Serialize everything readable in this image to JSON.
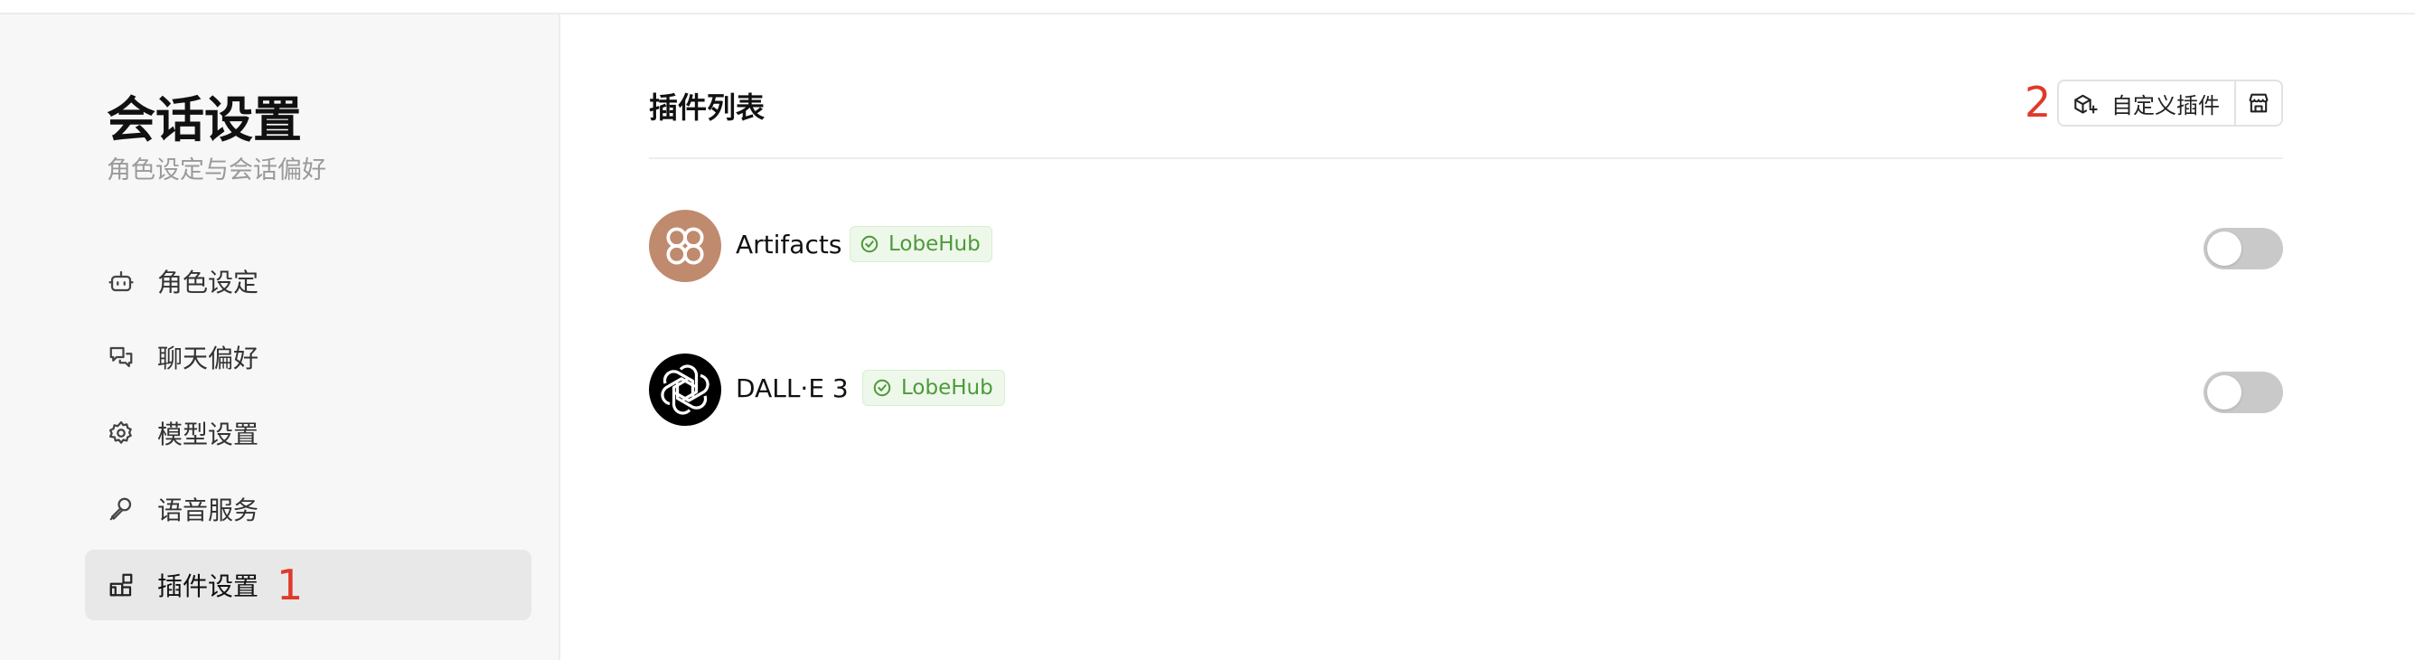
{
  "sidebar": {
    "title": "会话设置",
    "subtitle": "角色设定与会话偏好",
    "items": [
      {
        "label": "角色设定",
        "icon": "robot-icon"
      },
      {
        "label": "聊天偏好",
        "icon": "chat-bubbles-icon"
      },
      {
        "label": "模型设置",
        "icon": "brain-gear-icon"
      },
      {
        "label": "语音服务",
        "icon": "microphone-icon"
      },
      {
        "label": "插件设置",
        "icon": "blocks-icon",
        "active": true
      }
    ],
    "annotation": "1"
  },
  "main": {
    "title": "插件列表",
    "annotation": "2",
    "custom_plugin_button": "自定义插件",
    "store_button_icon": "store-icon",
    "plugins": [
      {
        "name": "Artifacts",
        "badge": "LobeHub",
        "enabled": false,
        "avatar_color": "#c08a6e",
        "icon": "flower-icon"
      },
      {
        "name": "DALL·E 3",
        "badge": "LobeHub",
        "enabled": false,
        "avatar_color": "#000000",
        "icon": "openai-icon"
      }
    ]
  },
  "colors": {
    "accent_annotation": "#e0392b",
    "badge_green": "#4c9a3b",
    "sidebar_bg": "#f7f7f7",
    "active_item_bg": "#e8e8e8",
    "toggle_off": "#c9c9c9"
  }
}
